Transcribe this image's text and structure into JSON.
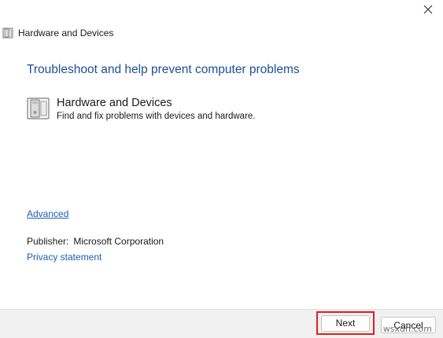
{
  "window": {
    "title": "Hardware and Devices"
  },
  "main": {
    "heading": "Troubleshoot and help prevent computer problems",
    "item": {
      "icon": "hardware-devices-icon",
      "title": "Hardware and Devices",
      "description": "Find and fix problems with devices and hardware."
    },
    "advanced_link": "Advanced",
    "publisher_label": "Publisher:",
    "publisher_value": "Microsoft Corporation",
    "privacy_link": "Privacy statement"
  },
  "footer": {
    "next_label": "Next",
    "cancel_label": "Cancel"
  },
  "watermark": "wsxdn.com",
  "colors": {
    "heading": "#1f4e99",
    "link": "#1f5fb0",
    "highlight": "#e01e1e"
  }
}
